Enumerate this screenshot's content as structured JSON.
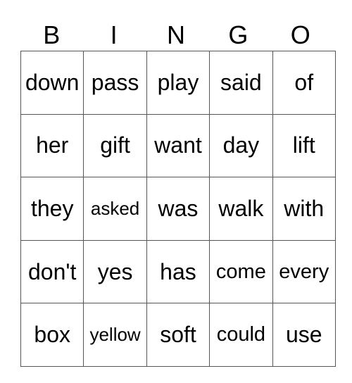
{
  "header": [
    "B",
    "I",
    "N",
    "G",
    "O"
  ],
  "rows": [
    [
      "down",
      "pass",
      "play",
      "said",
      "of"
    ],
    [
      "her",
      "gift",
      "want",
      "day",
      "lift"
    ],
    [
      "they",
      "asked",
      "was",
      "walk",
      "with"
    ],
    [
      "don't",
      "yes",
      "has",
      "come",
      "every"
    ],
    [
      "box",
      "yellow",
      "soft",
      "could",
      "use"
    ]
  ]
}
